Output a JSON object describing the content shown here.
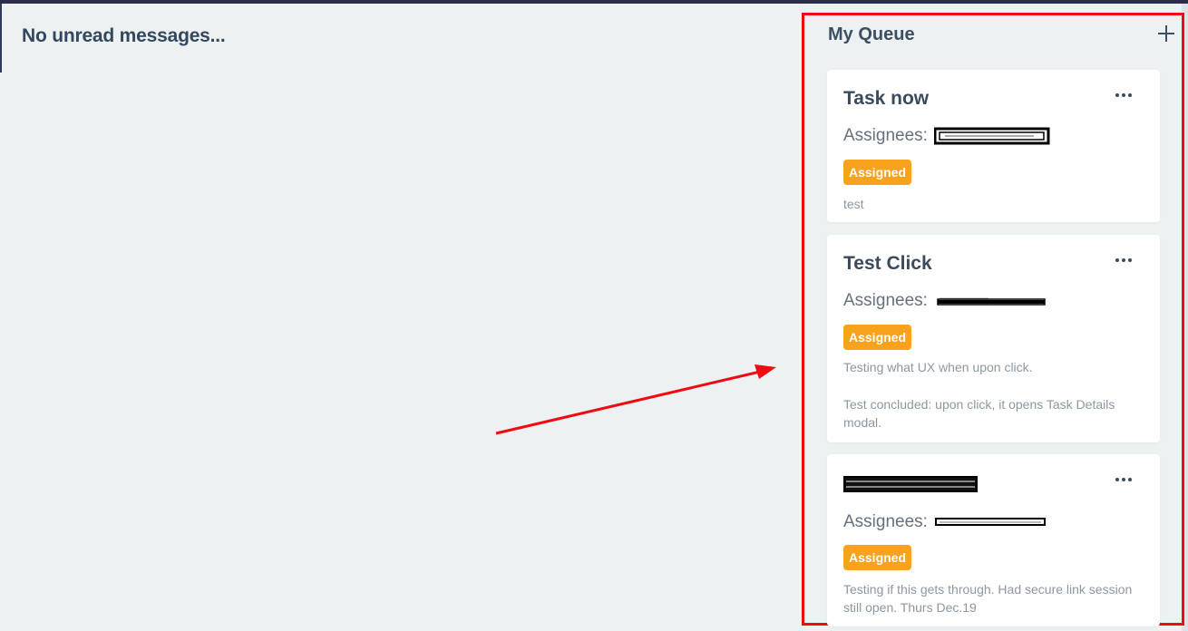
{
  "left_panel": {
    "title": "No unread messages..."
  },
  "queue": {
    "title": "My Queue",
    "add_icon": "plus-icon",
    "cards": [
      {
        "title": "Task now",
        "assignees_label": "Assignees:",
        "status": "Assigned",
        "description": "test"
      },
      {
        "title": "Test Click",
        "assignees_label": "Assignees:",
        "status": "Assigned",
        "description": "Testing what UX when upon click.",
        "description2": "Test concluded: upon click, it opens Task Details modal."
      },
      {
        "title": "",
        "assignees_label": "Assignees:",
        "status": "Assigned",
        "description": "Testing if this gets through. Had secure link session still open. Thurs Dec.19"
      }
    ]
  },
  "colors": {
    "highlight_box": "#ee0b12",
    "badge": "#f8a21d",
    "arrow": "#ee0b12",
    "background": "#edf1f2"
  }
}
